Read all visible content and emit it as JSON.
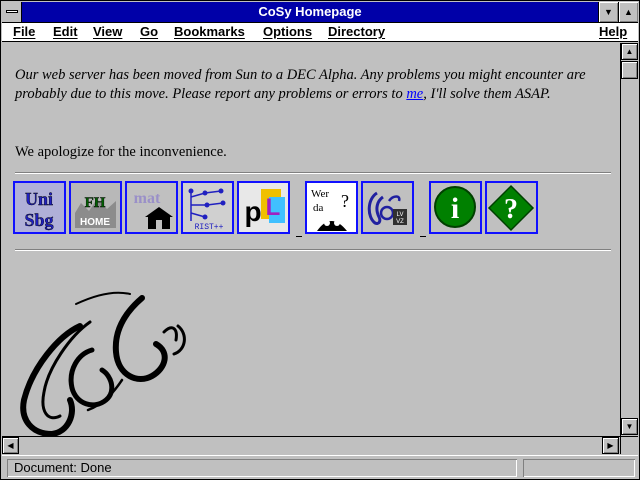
{
  "window": {
    "title": "CoSy Homepage"
  },
  "menu": [
    "File",
    "Edit",
    "View",
    "Go",
    "Bookmarks",
    "Options",
    "Directory",
    "Help"
  ],
  "content": {
    "notice_before_link": "Our web server has been moved from Sun to a DEC Alpha. Any problems you might encounter are probably due to this move. Please report any problems or errors to ",
    "notice_link": "me",
    "notice_after_link": ", I'll solve them ASAP.",
    "apology": "We apologize for the inconvenience."
  },
  "icons": [
    {
      "name": "uni-sbg-icon",
      "text": [
        "Uni",
        "Sbg"
      ]
    },
    {
      "name": "fh-home-icon",
      "text": [
        "FH",
        "HOME"
      ]
    },
    {
      "name": "mat-home-icon",
      "text": [
        "mat"
      ]
    },
    {
      "name": "rist-icon",
      "text": [
        "RIST++"
      ]
    },
    {
      "name": "pl-icon",
      "text": [
        "p",
        "L"
      ]
    },
    {
      "name": "wer-da-icon",
      "text": [
        "Wer",
        "da",
        "?"
      ]
    },
    {
      "name": "cosy-lv-icon",
      "text": [
        "LV",
        "VZ"
      ]
    },
    {
      "name": "info-icon",
      "text": [
        "i"
      ]
    },
    {
      "name": "help-icon",
      "text": [
        "?"
      ]
    }
  ],
  "status": {
    "text": "Document: Done"
  }
}
